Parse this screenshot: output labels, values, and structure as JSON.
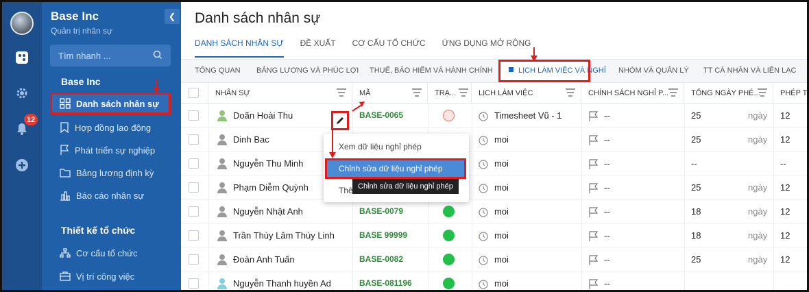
{
  "company": {
    "name": "Base Inc",
    "subtitle": "Quản trị nhân sự"
  },
  "rail": {
    "badge": "12",
    "icons": [
      "app-logo-icon",
      "settings-icon",
      "bell-icon",
      "add-icon"
    ]
  },
  "search": {
    "placeholder": "Tìm nhanh ..."
  },
  "sidebar": {
    "section1": "Base Inc",
    "items": [
      {
        "label": "Danh sách nhân sự",
        "icon": "grid-icon",
        "active": true
      },
      {
        "label": "Hợp đồng lao động",
        "icon": "bookmark-icon"
      },
      {
        "label": "Phát triển sự nghiệp",
        "icon": "flag-icon"
      },
      {
        "label": "Bảng lương định kỳ",
        "icon": "folder-icon"
      },
      {
        "label": "Báo cáo nhân sự",
        "icon": "chart-icon"
      }
    ],
    "section2": "Thiết kế tổ chức",
    "items2": [
      {
        "label": "Cơ cấu tổ chức",
        "icon": "org-icon"
      },
      {
        "label": "Vị trí công việc",
        "icon": "briefcase-icon"
      }
    ]
  },
  "page": {
    "title": "Danh sách nhân sự"
  },
  "tabs": [
    "DANH SÁCH NHÂN SỰ",
    "ĐỀ XUẤT",
    "CƠ CẤU TỔ CHỨC",
    "ỨNG DỤNG MỞ RỘNG"
  ],
  "subtabs": [
    "TỔNG QUAN",
    "BẢNG LƯƠNG VÀ PHÚC LỢI",
    "THUẾ, BẢO HIỂM VÀ HÀNH CHÍNH",
    "LỊCH LÀM VIỆC VÀ NGHỈ",
    "NHÓM VÀ QUẢN LÝ",
    "TT CÁ NHÂN VÀ LIÊN LẠC"
  ],
  "columns": [
    "NHÂN SỰ",
    "MÃ",
    "TRẠ...",
    "LỊCH LÀM VIỆC",
    "CHÍNH SÁCH NGHỈ P...",
    "TỔNG NGÀY PHÉ...",
    "PHÉP TR"
  ],
  "rows": [
    {
      "name": "Doãn Hoài Thu",
      "code": "BASE-0065",
      "status": "empty",
      "schedule": "Timesheet Vũ - 1",
      "policy": "--",
      "total": "25",
      "unit": "ngày",
      "rem": "12"
    },
    {
      "name": "Dinh Bac",
      "code": "",
      "status": "",
      "schedule": "moi",
      "policy": "--",
      "total": "25",
      "unit": "ngày",
      "rem": "12"
    },
    {
      "name": "Nguyễn Thu Minh",
      "code": "",
      "status": "",
      "schedule": "moi",
      "policy": "--",
      "total": "--",
      "unit": "",
      "rem": "--"
    },
    {
      "name": "Phạm Diễm Quỳnh",
      "code": "",
      "status": "",
      "schedule": "moi",
      "policy": "--",
      "total": "25",
      "unit": "ngày",
      "rem": "12"
    },
    {
      "name": "Nguyễn Nhật Anh",
      "code": "BASE-0079",
      "status": "green",
      "schedule": "moi",
      "policy": "--",
      "total": "18",
      "unit": "ngày",
      "rem": "12"
    },
    {
      "name": "Trần Thùy Lâm Thùy Linh",
      "code": "BASE 99999",
      "status": "green",
      "schedule": "moi",
      "policy": "--",
      "total": "18",
      "unit": "ngày",
      "rem": "12"
    },
    {
      "name": "Đoàn Anh Tuấn",
      "code": "BASE-0082",
      "status": "green",
      "schedule": "moi",
      "policy": "--",
      "total": "25",
      "unit": "ngày",
      "rem": "12"
    },
    {
      "name": "Nguyễn Thanh huyền Ad",
      "code": "BASE-081196",
      "status": "green",
      "schedule": "moi",
      "policy": "--",
      "total": "",
      "unit": "",
      "rem": ""
    }
  ],
  "context_menu": {
    "items": [
      "Xem dữ liệu nghỉ phép",
      "Chỉnh sửa dữ liệu nghỉ phép",
      "Thê"
    ]
  },
  "tooltip": "Chỉnh sửa dữ liệu nghỉ phép",
  "colors": {
    "sidebar": "#2060a8",
    "rail": "#1d4f8c",
    "accent": "#1f67b5",
    "highlight": "#e21b1b",
    "green": "#22c04a"
  }
}
